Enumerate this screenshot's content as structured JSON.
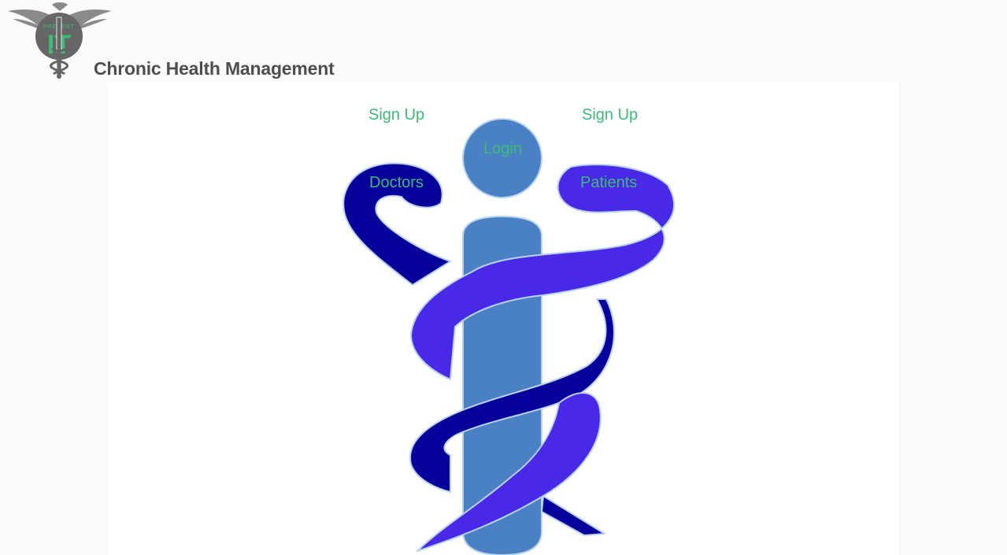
{
  "header": {
    "logo_text": "PREVENT IT",
    "title": "Chronic Health Management"
  },
  "nav": {
    "signup_doctors": "Sign Up",
    "signup_patients": "Sign Up",
    "login": "Login",
    "doctors": "Doctors",
    "patients": "Patients"
  },
  "colors": {
    "link_green": "#3dbb76",
    "title_gray": "#4e4e4e",
    "staff_blue": "#4a80c4",
    "serpent_navy": "#07009a",
    "serpent_violet": "#4a28e8"
  }
}
